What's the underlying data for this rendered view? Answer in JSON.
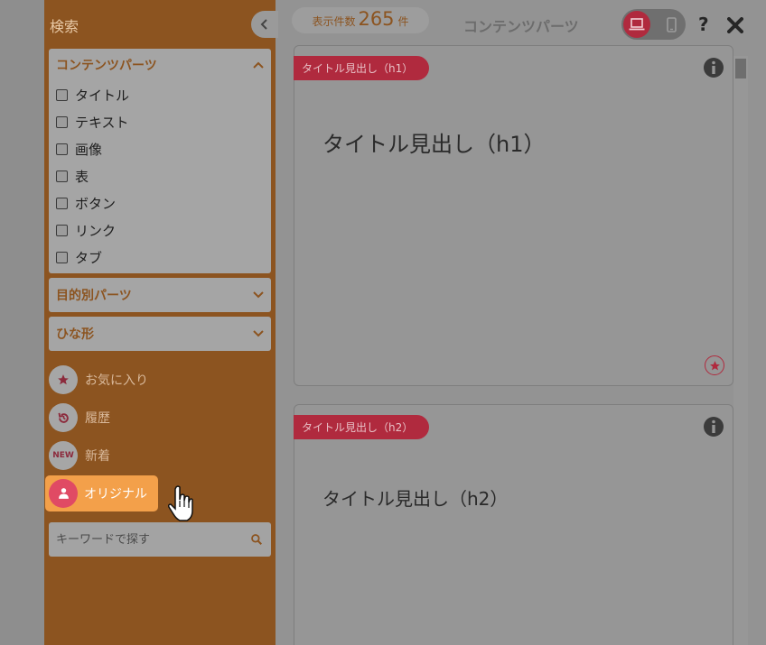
{
  "sidebar": {
    "title": "検索",
    "contents_panel": {
      "header": "コンテンツパーツ",
      "items": [
        "タイトル",
        "テキスト",
        "画像",
        "表",
        "ボタン",
        "リンク",
        "タブ"
      ]
    },
    "purpose_panel": {
      "header": "目的別パーツ"
    },
    "template_panel": {
      "header": "ひな形"
    },
    "nav": {
      "favorites": "お気に入り",
      "history": "履歴",
      "new": "新着",
      "new_badge": "NEW",
      "original": "オリジナル"
    },
    "search": {
      "placeholder": "キーワードで探す"
    }
  },
  "topbar": {
    "count_prefix": "表示件数",
    "count": "265",
    "count_suffix": "件",
    "title": "コンテンツパーツ",
    "help": "?"
  },
  "cards": [
    {
      "tag": "タイトル見出し（h1）",
      "heading": "タイトル見出し（h1）"
    },
    {
      "tag": "タイトル見出し（h2）",
      "heading": "タイトル見出し（h2）"
    }
  ],
  "colors": {
    "sidebar_bg": "#8c5420",
    "accent_red": "#b02a3e",
    "original_button": "#f3a04a",
    "overlay_gray": "#939393"
  },
  "icons": {
    "collapse": "chevron-left-icon",
    "panel_open": "chevron-up-icon",
    "panel_closed": "chevron-down-icon",
    "favorites": "star-icon",
    "history": "history-icon",
    "original": "user-icon",
    "search": "search-icon",
    "desktop": "laptop-icon",
    "mobile": "smartphone-icon",
    "close": "close-icon",
    "info": "info-icon"
  }
}
